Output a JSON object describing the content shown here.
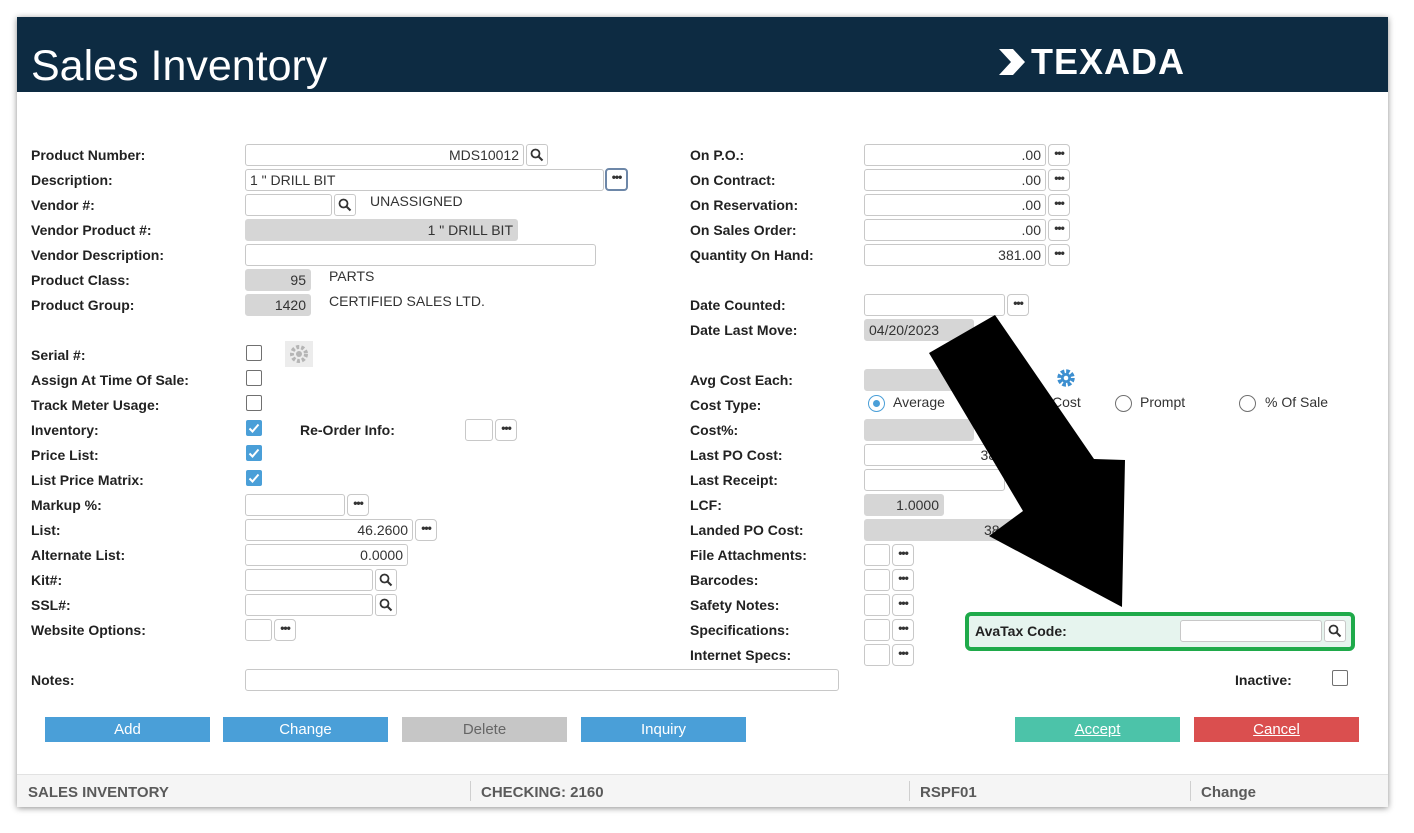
{
  "window_title": "Sales Inventory",
  "logo_text": "TEXADA",
  "colors": {
    "header": "#0d2b42",
    "accent": "#4a9fd8",
    "accept": "#4cc3a9",
    "cancel": "#da4f4f",
    "avatax_highlight": "#1faa4a"
  },
  "left": {
    "product_number": {
      "label": "Product Number:",
      "value": "MDS10012"
    },
    "description": {
      "label": "Description:",
      "value": "1 \" DRILL BIT"
    },
    "vendor": {
      "label": "Vendor #:",
      "value": "",
      "name": "UNASSIGNED"
    },
    "vendor_product": {
      "label": "Vendor Product #:",
      "value": "1 \" DRILL BIT"
    },
    "vendor_description": {
      "label": "Vendor Description:",
      "value": ""
    },
    "product_class": {
      "label": "Product Class:",
      "value": "95",
      "name": "PARTS"
    },
    "product_group": {
      "label": "Product Group:",
      "value": "1420",
      "name": "CERTIFIED SALES LTD."
    },
    "serial": {
      "label": "Serial #:"
    },
    "assign_at_sale": {
      "label": "Assign At Time Of Sale:"
    },
    "track_meter": {
      "label": "Track Meter Usage:"
    },
    "inventory": {
      "label": "Inventory:"
    },
    "reorder_info": {
      "label": "Re-Order Info:"
    },
    "price_list": {
      "label": "Price List:"
    },
    "list_price_matrix": {
      "label": "List Price Matrix:"
    },
    "markup": {
      "label": "Markup %:",
      "value": ""
    },
    "list": {
      "label": "List:",
      "value": "46.2600"
    },
    "alternate_list": {
      "label": "Alternate List:",
      "value": "0.0000"
    },
    "kit": {
      "label": "Kit#:",
      "value": ""
    },
    "ssl": {
      "label": "SSL#:",
      "value": ""
    },
    "website_options": {
      "label": "Website Options:"
    },
    "notes": {
      "label": "Notes:",
      "value": ""
    }
  },
  "right": {
    "on_po": {
      "label": "On P.O.:",
      "value": ".00"
    },
    "on_contract": {
      "label": "On Contract:",
      "value": ".00"
    },
    "on_reservation": {
      "label": "On Reservation:",
      "value": ".00"
    },
    "on_sales_order": {
      "label": "On Sales Order:",
      "value": ".00"
    },
    "quantity_on_hand": {
      "label": "Quantity On Hand:",
      "value": "381.00"
    },
    "date_counted": {
      "label": "Date Counted:",
      "value": ""
    },
    "date_last_move": {
      "label": "Date Last Move:",
      "value": "04/20/2023"
    },
    "avg_cost_each": {
      "label": "Avg Cost Each:",
      "value": ""
    },
    "cost_type": {
      "label": "Cost Type:",
      "options": [
        "Average",
        "Cost",
        "Prompt",
        "% Of Sale"
      ],
      "selected": "Average"
    },
    "cost_pct": {
      "label": "Cost%:",
      "value": ""
    },
    "last_po_cost": {
      "label": "Last PO Cost:",
      "value": "38."
    },
    "last_receipt": {
      "label": "Last Receipt:",
      "value": ""
    },
    "lcf": {
      "label": "LCF:",
      "value": "1.0000"
    },
    "landed_po_cost": {
      "label": "Landed PO Cost:",
      "value": "38.55"
    },
    "file_attachments": {
      "label": "File Attachments:"
    },
    "barcodes": {
      "label": "Barcodes:"
    },
    "safety_notes": {
      "label": "Safety Notes:"
    },
    "specifications": {
      "label": "Specifications:"
    },
    "internet_specs": {
      "label": "Internet Specs:"
    },
    "avatax_code": {
      "label": "AvaTax Code:",
      "value": ""
    },
    "inactive": {
      "label": "Inactive:"
    }
  },
  "actions": {
    "add": "Add",
    "change": "Change",
    "delete": "Delete",
    "inquiry": "Inquiry",
    "accept": "Accept",
    "cancel": "Cancel"
  },
  "status": {
    "module": "SALES INVENTORY",
    "checking": "CHECKING: 2160",
    "program": "RSPF01",
    "mode": "Change"
  },
  "icons": {
    "search": "search-icon",
    "more": "ellipsis-icon",
    "gear": "gear-icon",
    "check": "check-icon",
    "arrow": "arrow-annotation"
  }
}
